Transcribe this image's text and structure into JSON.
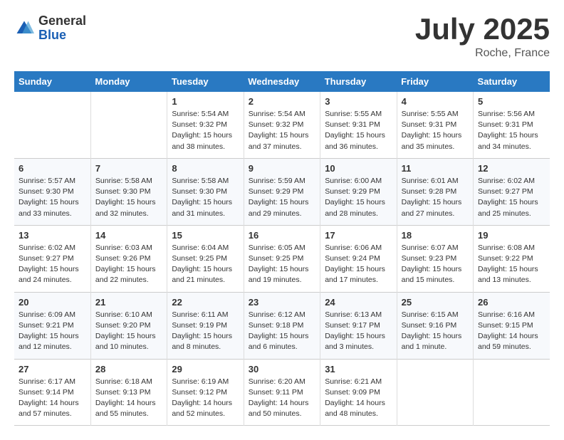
{
  "logo": {
    "general": "General",
    "blue": "Blue"
  },
  "title": "July 2025",
  "subtitle": "Roche, France",
  "days_header": [
    "Sunday",
    "Monday",
    "Tuesday",
    "Wednesday",
    "Thursday",
    "Friday",
    "Saturday"
  ],
  "weeks": [
    [
      {
        "day": "",
        "info": ""
      },
      {
        "day": "",
        "info": ""
      },
      {
        "day": "1",
        "sunrise": "5:54 AM",
        "sunset": "9:32 PM",
        "daylight": "15 hours and 38 minutes."
      },
      {
        "day": "2",
        "sunrise": "5:54 AM",
        "sunset": "9:32 PM",
        "daylight": "15 hours and 37 minutes."
      },
      {
        "day": "3",
        "sunrise": "5:55 AM",
        "sunset": "9:31 PM",
        "daylight": "15 hours and 36 minutes."
      },
      {
        "day": "4",
        "sunrise": "5:55 AM",
        "sunset": "9:31 PM",
        "daylight": "15 hours and 35 minutes."
      },
      {
        "day": "5",
        "sunrise": "5:56 AM",
        "sunset": "9:31 PM",
        "daylight": "15 hours and 34 minutes."
      }
    ],
    [
      {
        "day": "6",
        "sunrise": "5:57 AM",
        "sunset": "9:30 PM",
        "daylight": "15 hours and 33 minutes."
      },
      {
        "day": "7",
        "sunrise": "5:58 AM",
        "sunset": "9:30 PM",
        "daylight": "15 hours and 32 minutes."
      },
      {
        "day": "8",
        "sunrise": "5:58 AM",
        "sunset": "9:30 PM",
        "daylight": "15 hours and 31 minutes."
      },
      {
        "day": "9",
        "sunrise": "5:59 AM",
        "sunset": "9:29 PM",
        "daylight": "15 hours and 29 minutes."
      },
      {
        "day": "10",
        "sunrise": "6:00 AM",
        "sunset": "9:29 PM",
        "daylight": "15 hours and 28 minutes."
      },
      {
        "day": "11",
        "sunrise": "6:01 AM",
        "sunset": "9:28 PM",
        "daylight": "15 hours and 27 minutes."
      },
      {
        "day": "12",
        "sunrise": "6:02 AM",
        "sunset": "9:27 PM",
        "daylight": "15 hours and 25 minutes."
      }
    ],
    [
      {
        "day": "13",
        "sunrise": "6:02 AM",
        "sunset": "9:27 PM",
        "daylight": "15 hours and 24 minutes."
      },
      {
        "day": "14",
        "sunrise": "6:03 AM",
        "sunset": "9:26 PM",
        "daylight": "15 hours and 22 minutes."
      },
      {
        "day": "15",
        "sunrise": "6:04 AM",
        "sunset": "9:25 PM",
        "daylight": "15 hours and 21 minutes."
      },
      {
        "day": "16",
        "sunrise": "6:05 AM",
        "sunset": "9:25 PM",
        "daylight": "15 hours and 19 minutes."
      },
      {
        "day": "17",
        "sunrise": "6:06 AM",
        "sunset": "9:24 PM",
        "daylight": "15 hours and 17 minutes."
      },
      {
        "day": "18",
        "sunrise": "6:07 AM",
        "sunset": "9:23 PM",
        "daylight": "15 hours and 15 minutes."
      },
      {
        "day": "19",
        "sunrise": "6:08 AM",
        "sunset": "9:22 PM",
        "daylight": "15 hours and 13 minutes."
      }
    ],
    [
      {
        "day": "20",
        "sunrise": "6:09 AM",
        "sunset": "9:21 PM",
        "daylight": "15 hours and 12 minutes."
      },
      {
        "day": "21",
        "sunrise": "6:10 AM",
        "sunset": "9:20 PM",
        "daylight": "15 hours and 10 minutes."
      },
      {
        "day": "22",
        "sunrise": "6:11 AM",
        "sunset": "9:19 PM",
        "daylight": "15 hours and 8 minutes."
      },
      {
        "day": "23",
        "sunrise": "6:12 AM",
        "sunset": "9:18 PM",
        "daylight": "15 hours and 6 minutes."
      },
      {
        "day": "24",
        "sunrise": "6:13 AM",
        "sunset": "9:17 PM",
        "daylight": "15 hours and 3 minutes."
      },
      {
        "day": "25",
        "sunrise": "6:15 AM",
        "sunset": "9:16 PM",
        "daylight": "15 hours and 1 minute."
      },
      {
        "day": "26",
        "sunrise": "6:16 AM",
        "sunset": "9:15 PM",
        "daylight": "14 hours and 59 minutes."
      }
    ],
    [
      {
        "day": "27",
        "sunrise": "6:17 AM",
        "sunset": "9:14 PM",
        "daylight": "14 hours and 57 minutes."
      },
      {
        "day": "28",
        "sunrise": "6:18 AM",
        "sunset": "9:13 PM",
        "daylight": "14 hours and 55 minutes."
      },
      {
        "day": "29",
        "sunrise": "6:19 AM",
        "sunset": "9:12 PM",
        "daylight": "14 hours and 52 minutes."
      },
      {
        "day": "30",
        "sunrise": "6:20 AM",
        "sunset": "9:11 PM",
        "daylight": "14 hours and 50 minutes."
      },
      {
        "day": "31",
        "sunrise": "6:21 AM",
        "sunset": "9:09 PM",
        "daylight": "14 hours and 48 minutes."
      },
      {
        "day": "",
        "info": ""
      },
      {
        "day": "",
        "info": ""
      }
    ]
  ]
}
